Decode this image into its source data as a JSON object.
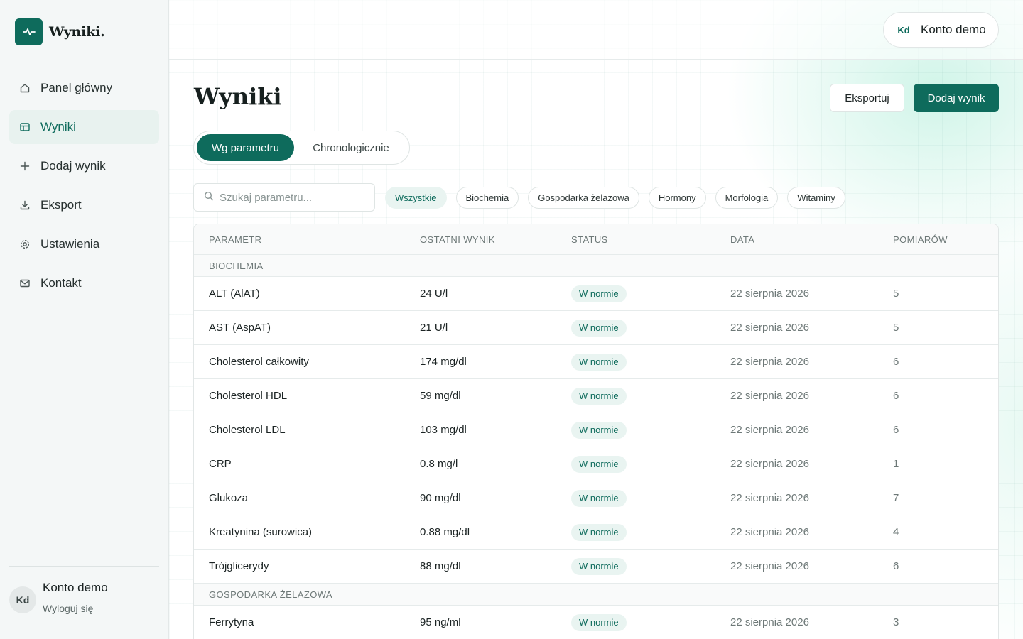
{
  "brand": {
    "name": "Wyniki.",
    "logo_icon": "pulse-icon"
  },
  "sidebar": {
    "items": [
      {
        "label": "Panel główny",
        "icon": "home-icon",
        "active": false
      },
      {
        "label": "Wyniki",
        "icon": "table-icon",
        "active": true
      },
      {
        "label": "Dodaj wynik",
        "icon": "plus-icon",
        "active": false
      },
      {
        "label": "Eksport",
        "icon": "download-icon",
        "active": false
      },
      {
        "label": "Ustawienia",
        "icon": "gear-icon",
        "active": false
      },
      {
        "label": "Kontakt",
        "icon": "mail-icon",
        "active": false
      }
    ],
    "user": {
      "initials": "Kd",
      "name": "Konto demo",
      "logout_label": "Wyloguj się"
    }
  },
  "topbar": {
    "account_initials": "Kd",
    "account_name": "Konto demo"
  },
  "page": {
    "title": "Wyniki",
    "export_label": "Eksportuj",
    "add_label": "Dodaj wynik",
    "view_tabs": [
      "Wg parametru",
      "Chronologicznie"
    ],
    "search_placeholder": "Szukaj parametru...",
    "filters": [
      "Wszystkie",
      "Biochemia",
      "Gospodarka żelazowa",
      "Hormony",
      "Morfologia",
      "Witaminy"
    ],
    "active_filter": "Wszystkie"
  },
  "table": {
    "headers": [
      "PARAMETR",
      "OSTATNI WYNIK",
      "STATUS",
      "DATA",
      "POMIARÓW"
    ],
    "groups": [
      {
        "name": "BIOCHEMIA",
        "rows": [
          [
            "ALT (AlAT)",
            "24 U/l",
            "W normie",
            "22 sierpnia 2026",
            "5"
          ],
          [
            "AST (AspAT)",
            "21 U/l",
            "W normie",
            "22 sierpnia 2026",
            "5"
          ],
          [
            "Cholesterol całkowity",
            "174 mg/dl",
            "W normie",
            "22 sierpnia 2026",
            "6"
          ],
          [
            "Cholesterol HDL",
            "59 mg/dl",
            "W normie",
            "22 sierpnia 2026",
            "6"
          ],
          [
            "Cholesterol LDL",
            "103 mg/dl",
            "W normie",
            "22 sierpnia 2026",
            "6"
          ],
          [
            "CRP",
            "0.8 mg/l",
            "W normie",
            "22 sierpnia 2026",
            "1"
          ],
          [
            "Glukoza",
            "90 mg/dl",
            "W normie",
            "22 sierpnia 2026",
            "7"
          ],
          [
            "Kreatynina (surowica)",
            "0.88 mg/dl",
            "W normie",
            "22 sierpnia 2026",
            "4"
          ],
          [
            "Trójglicerydy",
            "88 mg/dl",
            "W normie",
            "22 sierpnia 2026",
            "6"
          ]
        ]
      },
      {
        "name": "GOSPODARKA ŻELAZOWA",
        "rows": [
          [
            "Ferrytyna",
            "95 ng/ml",
            "W normie",
            "22 sierpnia 2026",
            "3"
          ]
        ]
      }
    ]
  },
  "colors": {
    "accent": "#0e6b5c",
    "accent_soft": "#e9f4f1",
    "sidebar_bg": "#f4f7f7"
  }
}
